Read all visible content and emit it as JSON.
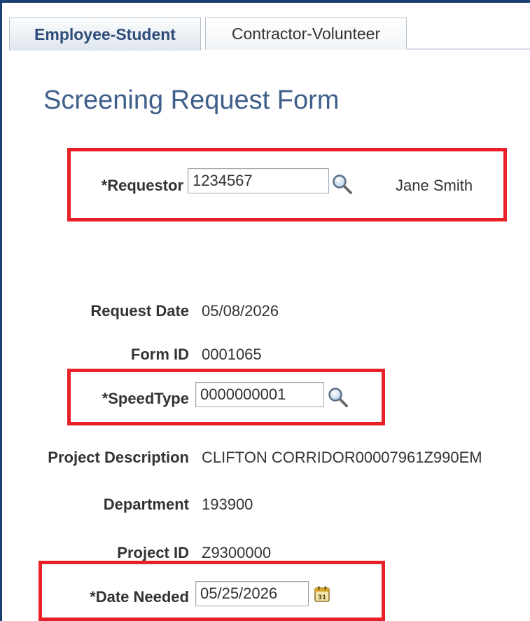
{
  "tabs": [
    {
      "label": "Employee-Student",
      "active": true
    },
    {
      "label": "Contractor-Volunteer",
      "active": false
    }
  ],
  "page_title": "Screening Request Form",
  "form": {
    "requestor": {
      "label": "*Requestor",
      "value": "1234567",
      "name": "Jane Smith"
    },
    "request_date": {
      "label": "Request Date",
      "value": "05/08/2026"
    },
    "form_id": {
      "label": "Form ID",
      "value": "0001065"
    },
    "speedtype": {
      "label": "*SpeedType",
      "value": "0000000001"
    },
    "project_description": {
      "label": "Project Description",
      "value": "CLIFTON CORRIDOR00007961Z990EM"
    },
    "department": {
      "label": "Department",
      "value": "193900"
    },
    "project_id": {
      "label": "Project ID",
      "value": "Z9300000"
    },
    "date_needed": {
      "label": "*Date Needed",
      "value": "05/25/2026"
    }
  },
  "icons": {
    "requestor_lookup": "magnifier-lookup-icon",
    "speedtype_lookup": "magnifier-lookup-icon",
    "date_needed_picker": "calendar-icon"
  },
  "colors": {
    "highlight": "#e8202a",
    "title": "#3f5f8a",
    "frame": "#1c3f73",
    "active_tab_text": "#2f4d7a"
  }
}
